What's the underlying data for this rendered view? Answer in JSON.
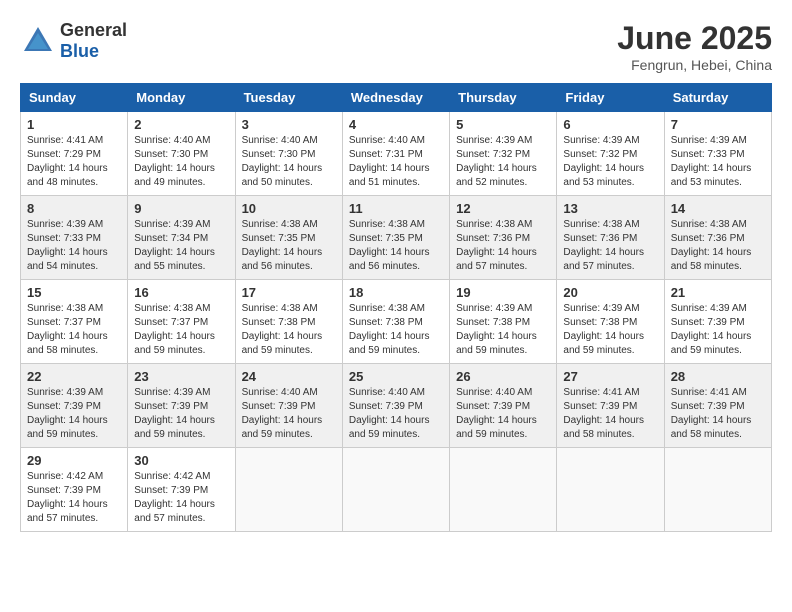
{
  "header": {
    "logo_general": "General",
    "logo_blue": "Blue",
    "title": "June 2025",
    "subtitle": "Fengrun, Hebei, China"
  },
  "days_of_week": [
    "Sunday",
    "Monday",
    "Tuesday",
    "Wednesday",
    "Thursday",
    "Friday",
    "Saturday"
  ],
  "weeks": [
    [
      {
        "day": "1",
        "info": "Sunrise: 4:41 AM\nSunset: 7:29 PM\nDaylight: 14 hours\nand 48 minutes."
      },
      {
        "day": "2",
        "info": "Sunrise: 4:40 AM\nSunset: 7:30 PM\nDaylight: 14 hours\nand 49 minutes."
      },
      {
        "day": "3",
        "info": "Sunrise: 4:40 AM\nSunset: 7:30 PM\nDaylight: 14 hours\nand 50 minutes."
      },
      {
        "day": "4",
        "info": "Sunrise: 4:40 AM\nSunset: 7:31 PM\nDaylight: 14 hours\nand 51 minutes."
      },
      {
        "day": "5",
        "info": "Sunrise: 4:39 AM\nSunset: 7:32 PM\nDaylight: 14 hours\nand 52 minutes."
      },
      {
        "day": "6",
        "info": "Sunrise: 4:39 AM\nSunset: 7:32 PM\nDaylight: 14 hours\nand 53 minutes."
      },
      {
        "day": "7",
        "info": "Sunrise: 4:39 AM\nSunset: 7:33 PM\nDaylight: 14 hours\nand 53 minutes."
      }
    ],
    [
      {
        "day": "8",
        "info": "Sunrise: 4:39 AM\nSunset: 7:33 PM\nDaylight: 14 hours\nand 54 minutes."
      },
      {
        "day": "9",
        "info": "Sunrise: 4:39 AM\nSunset: 7:34 PM\nDaylight: 14 hours\nand 55 minutes."
      },
      {
        "day": "10",
        "info": "Sunrise: 4:38 AM\nSunset: 7:35 PM\nDaylight: 14 hours\nand 56 minutes."
      },
      {
        "day": "11",
        "info": "Sunrise: 4:38 AM\nSunset: 7:35 PM\nDaylight: 14 hours\nand 56 minutes."
      },
      {
        "day": "12",
        "info": "Sunrise: 4:38 AM\nSunset: 7:36 PM\nDaylight: 14 hours\nand 57 minutes."
      },
      {
        "day": "13",
        "info": "Sunrise: 4:38 AM\nSunset: 7:36 PM\nDaylight: 14 hours\nand 57 minutes."
      },
      {
        "day": "14",
        "info": "Sunrise: 4:38 AM\nSunset: 7:36 PM\nDaylight: 14 hours\nand 58 minutes."
      }
    ],
    [
      {
        "day": "15",
        "info": "Sunrise: 4:38 AM\nSunset: 7:37 PM\nDaylight: 14 hours\nand 58 minutes."
      },
      {
        "day": "16",
        "info": "Sunrise: 4:38 AM\nSunset: 7:37 PM\nDaylight: 14 hours\nand 59 minutes."
      },
      {
        "day": "17",
        "info": "Sunrise: 4:38 AM\nSunset: 7:38 PM\nDaylight: 14 hours\nand 59 minutes."
      },
      {
        "day": "18",
        "info": "Sunrise: 4:38 AM\nSunset: 7:38 PM\nDaylight: 14 hours\nand 59 minutes."
      },
      {
        "day": "19",
        "info": "Sunrise: 4:39 AM\nSunset: 7:38 PM\nDaylight: 14 hours\nand 59 minutes."
      },
      {
        "day": "20",
        "info": "Sunrise: 4:39 AM\nSunset: 7:38 PM\nDaylight: 14 hours\nand 59 minutes."
      },
      {
        "day": "21",
        "info": "Sunrise: 4:39 AM\nSunset: 7:39 PM\nDaylight: 14 hours\nand 59 minutes."
      }
    ],
    [
      {
        "day": "22",
        "info": "Sunrise: 4:39 AM\nSunset: 7:39 PM\nDaylight: 14 hours\nand 59 minutes."
      },
      {
        "day": "23",
        "info": "Sunrise: 4:39 AM\nSunset: 7:39 PM\nDaylight: 14 hours\nand 59 minutes."
      },
      {
        "day": "24",
        "info": "Sunrise: 4:40 AM\nSunset: 7:39 PM\nDaylight: 14 hours\nand 59 minutes."
      },
      {
        "day": "25",
        "info": "Sunrise: 4:40 AM\nSunset: 7:39 PM\nDaylight: 14 hours\nand 59 minutes."
      },
      {
        "day": "26",
        "info": "Sunrise: 4:40 AM\nSunset: 7:39 PM\nDaylight: 14 hours\nand 59 minutes."
      },
      {
        "day": "27",
        "info": "Sunrise: 4:41 AM\nSunset: 7:39 PM\nDaylight: 14 hours\nand 58 minutes."
      },
      {
        "day": "28",
        "info": "Sunrise: 4:41 AM\nSunset: 7:39 PM\nDaylight: 14 hours\nand 58 minutes."
      }
    ],
    [
      {
        "day": "29",
        "info": "Sunrise: 4:42 AM\nSunset: 7:39 PM\nDaylight: 14 hours\nand 57 minutes."
      },
      {
        "day": "30",
        "info": "Sunrise: 4:42 AM\nSunset: 7:39 PM\nDaylight: 14 hours\nand 57 minutes."
      },
      {
        "day": "",
        "info": ""
      },
      {
        "day": "",
        "info": ""
      },
      {
        "day": "",
        "info": ""
      },
      {
        "day": "",
        "info": ""
      },
      {
        "day": "",
        "info": ""
      }
    ]
  ]
}
